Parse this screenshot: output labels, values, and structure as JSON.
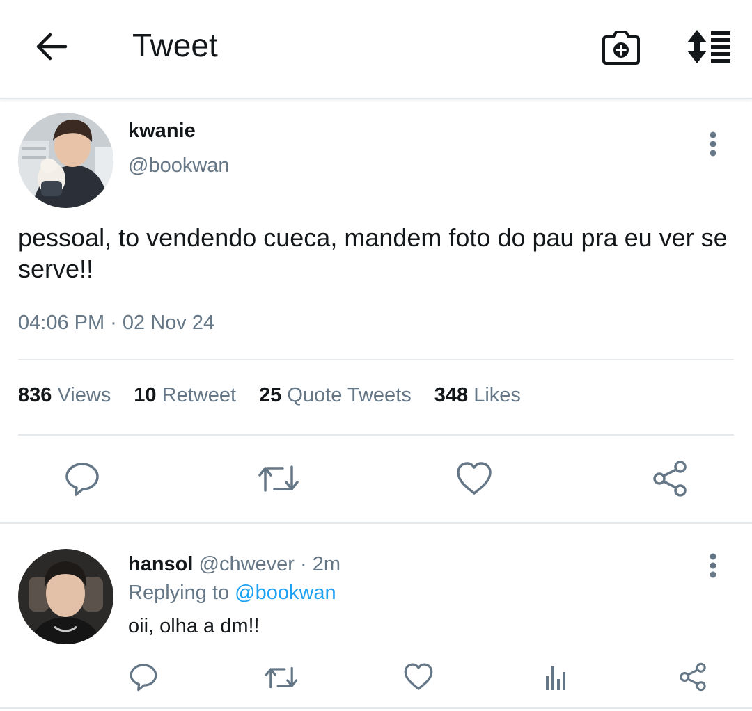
{
  "header": {
    "title": "Tweet",
    "back_icon": "arrow-left-icon",
    "camera_icon": "camera-add-icon",
    "sort_icon": "sort-list-icon"
  },
  "tweet": {
    "author_name": "kwanie",
    "author_handle": "@bookwan",
    "text": "pessoal, to vendendo cueca, mandem foto do pau pra eu ver se serve!!",
    "timestamp": "04:06 PM · 02 Nov 24",
    "stats": {
      "views": "836",
      "views_label": "Views",
      "retweets": "10",
      "retweets_label": "Retweet",
      "quotes": "25",
      "quotes_label": "Quote Tweets",
      "likes": "348",
      "likes_label": "Likes"
    }
  },
  "reply": {
    "author_name": "hansol",
    "author_handle": "@chwever",
    "time": "· 2m",
    "replying_label": "Replying to",
    "replying_to": "@bookwan",
    "text": "oii, olha a dm!!"
  },
  "colors": {
    "text": "#14171a",
    "secondary": "#657786",
    "link": "#1da1f2",
    "divider": "#e6e9ec"
  }
}
